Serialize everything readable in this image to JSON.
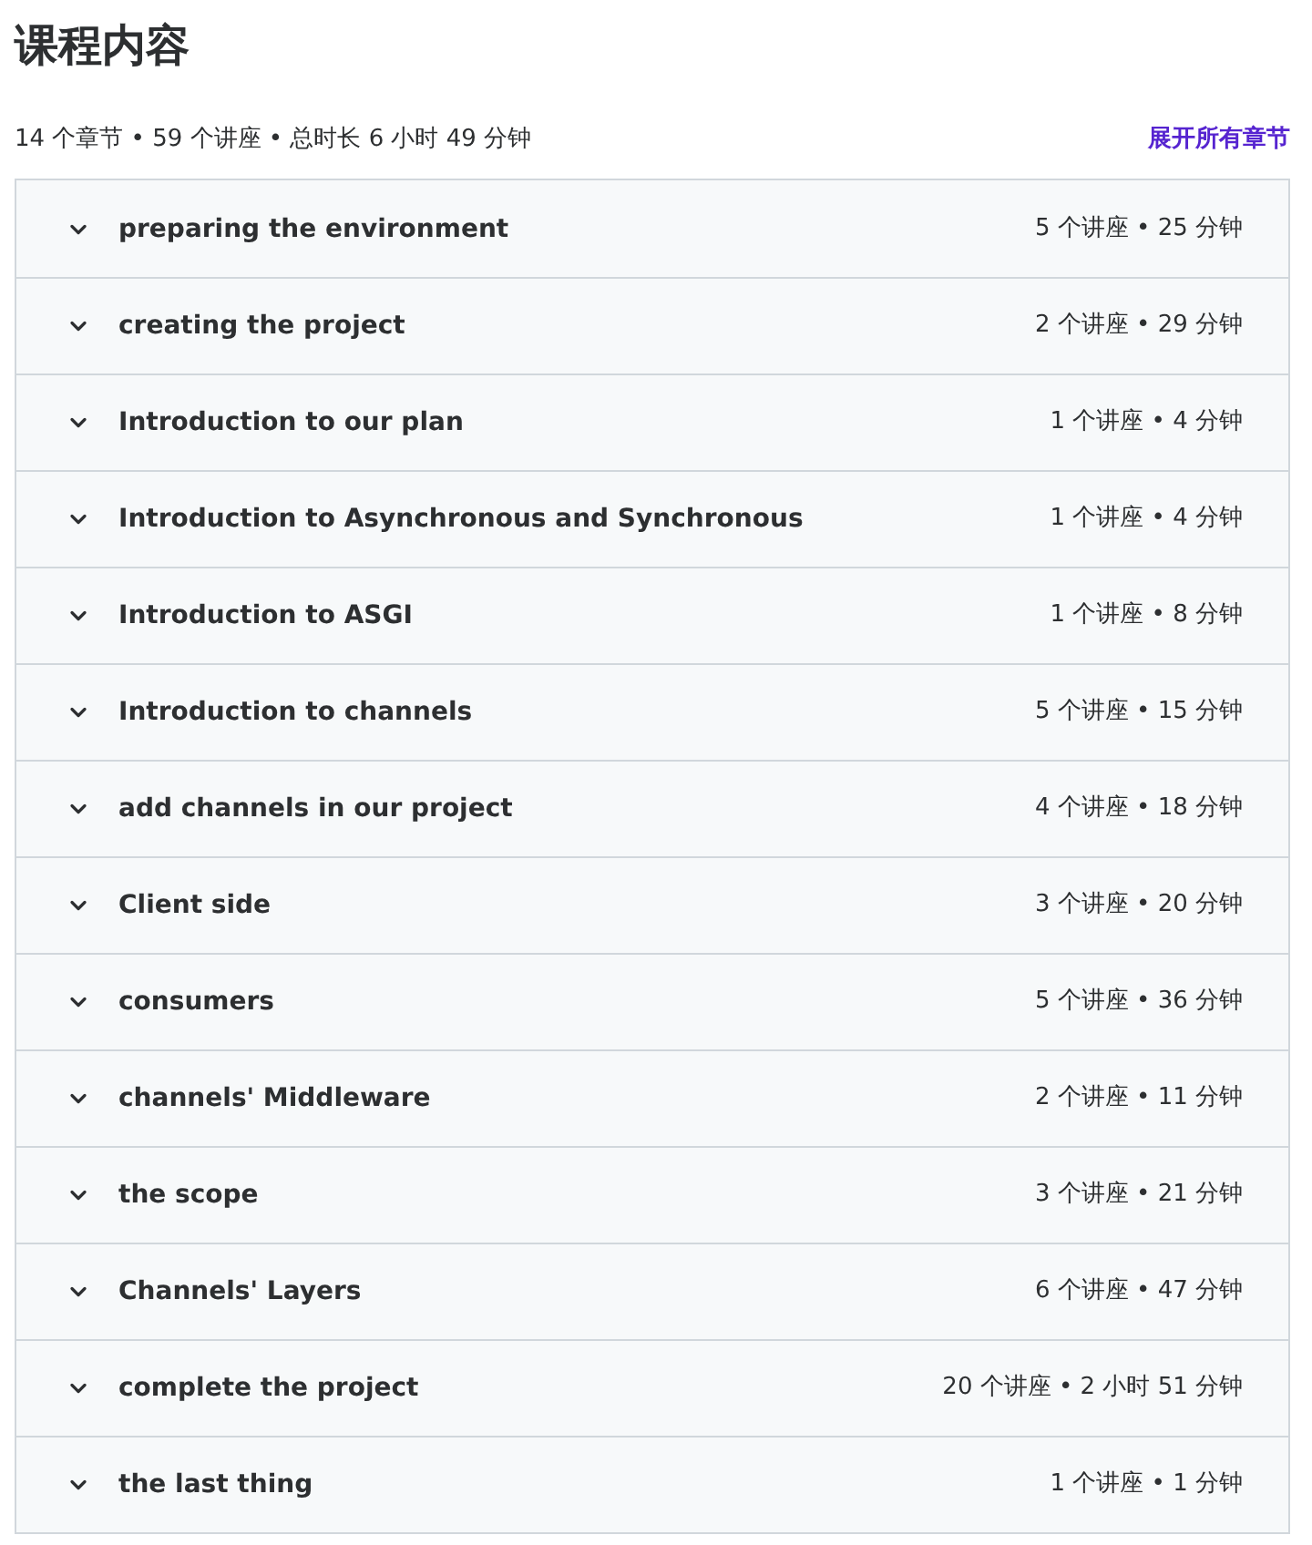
{
  "title": "课程内容",
  "summary": "14 个章节 • 59 个讲座 • 总时长 6 小时 49 分钟",
  "expand_all_link": "展开所有章节",
  "sections": [
    {
      "title": "preparing the environment",
      "meta": "5 个讲座 • 25 分钟",
      "expanded": false
    },
    {
      "title": "creating the project",
      "meta": "2 个讲座 • 29 分钟",
      "expanded": false
    },
    {
      "title": "Introduction to our plan",
      "meta": "1 个讲座 • 4 分钟",
      "expanded": false
    },
    {
      "title": "Introduction to Asynchronous and Synchronous",
      "meta": "1 个讲座 • 4 分钟",
      "expanded": false
    },
    {
      "title": "Introduction to ASGI",
      "meta": "1 个讲座 • 8 分钟",
      "expanded": false
    },
    {
      "title": "Introduction to channels",
      "meta": "5 个讲座 • 15 分钟",
      "expanded": false
    },
    {
      "title": "add channels in our project",
      "meta": "4 个讲座 • 18 分钟",
      "expanded": false
    },
    {
      "title": "Client side",
      "meta": "3 个讲座 • 20 分钟",
      "expanded": false
    },
    {
      "title": "consumers",
      "meta": "5 个讲座 • 36 分钟",
      "expanded": false
    },
    {
      "title": "channels' Middleware",
      "meta": "2 个讲座 • 11 分钟",
      "expanded": false
    },
    {
      "title": "the scope",
      "meta": "3 个讲座 • 21 分钟",
      "expanded": false
    },
    {
      "title": "Channels' Layers",
      "meta": "6 个讲座 • 47 分钟",
      "expanded": false
    },
    {
      "title": "complete the project",
      "meta": "20 个讲座 • 2 小时 51 分钟",
      "expanded": false
    },
    {
      "title": "the last thing",
      "meta": "1 个讲座 • 1 分钟",
      "expanded": false
    }
  ]
}
